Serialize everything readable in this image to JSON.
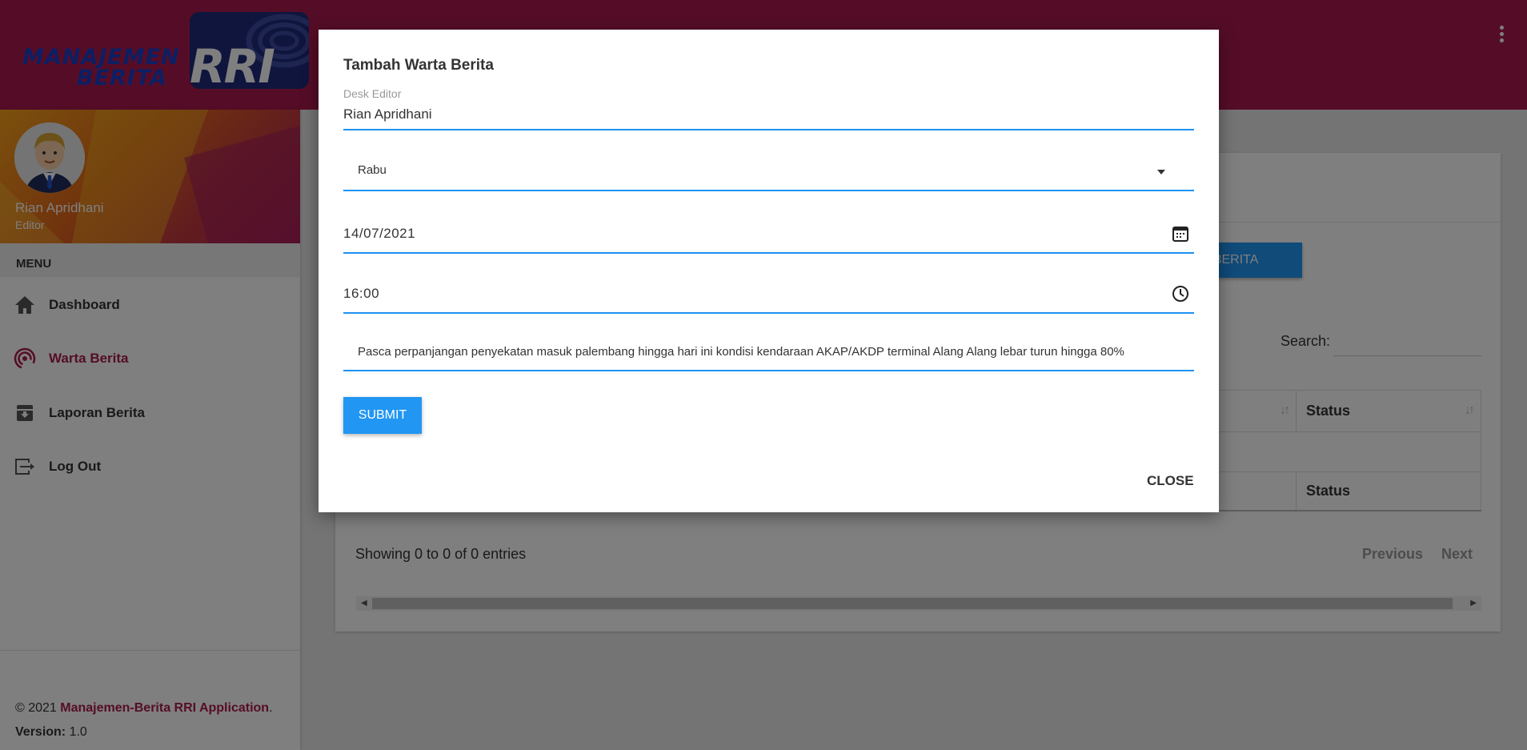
{
  "app": {
    "logo_line1": "MANAJEMEN",
    "logo_line2": "BERITA",
    "logo_badge": "RRI",
    "brand_color": "#ab1a4e",
    "accent_color": "#2196f3"
  },
  "sidebar": {
    "user_name": "Rian Apridhani",
    "user_role": "Editor",
    "menu_header": "MENU",
    "items": [
      {
        "label": "Dashboard",
        "icon": "home-icon",
        "active": false
      },
      {
        "label": "Warta Berita",
        "icon": "broadcast-icon",
        "active": true
      },
      {
        "label": "Laporan Berita",
        "icon": "archive-icon",
        "active": false
      },
      {
        "label": "Log Out",
        "icon": "logout-icon",
        "active": false
      }
    ],
    "footer": {
      "copyright_prefix": "© 2021 ",
      "app_name": "Manajemen-Berita RRI Application",
      "suffix": ".",
      "version_label": "Version:",
      "version_value": " 1.0"
    }
  },
  "main": {
    "add_button": "A BERITA",
    "search_label": "Search:",
    "table": {
      "headers": [
        "",
        "Status"
      ],
      "footers": [
        "",
        "Status"
      ]
    },
    "entries_info": "Showing 0 to 0 of 0 entries",
    "pager": {
      "previous": "Previous",
      "next": "Next"
    }
  },
  "modal": {
    "title": "Tambah Warta Berita",
    "editor_label": "Desk Editor",
    "editor_value": "Rian Apridhani",
    "day_value": "Rabu",
    "date_value": "14/07/2021",
    "time_value": "16:00",
    "news_value": "Pasca perpanjangan penyekatan masuk palembang hingga hari ini kondisi kendaraan AKAP/AKDP terminal Alang Alang lebar turun hingga 80%",
    "submit_label": "SUBMIT",
    "close_label": "CLOSE"
  }
}
